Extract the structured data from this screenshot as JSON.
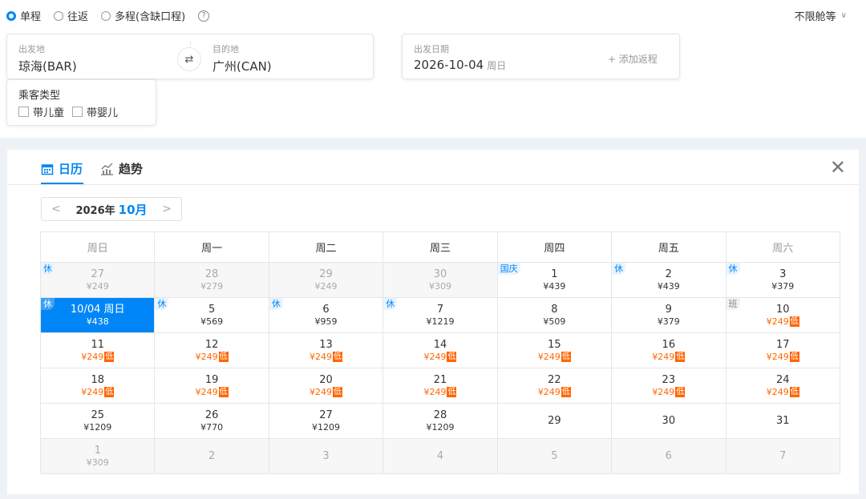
{
  "trip_types": [
    {
      "label": "单程",
      "selected": true
    },
    {
      "label": "往返",
      "selected": false
    },
    {
      "label": "多程(含缺口程)",
      "selected": false
    }
  ],
  "help_icon": "?",
  "cabin": "不限舱等",
  "route": {
    "from_label": "出发地",
    "from_value": "琼海(BAR)",
    "to_label": "目的地",
    "to_value": "广州(CAN)",
    "swap_icon": "⇄"
  },
  "date": {
    "label": "出发日期",
    "value": "2026-10-04",
    "weekday": "周日",
    "add_return": "+ 添加返程"
  },
  "passenger": {
    "label": "乘客类型",
    "options": [
      "带儿童",
      "带婴儿"
    ]
  },
  "tabs": {
    "calendar": "日历",
    "trend": "趋势"
  },
  "close_icon": "✕",
  "month": {
    "year": "2026年",
    "month": "10月"
  },
  "weekdays": [
    "周日",
    "周一",
    "周二",
    "周三",
    "周四",
    "周五",
    "周六"
  ],
  "low_tag": "低",
  "weeks": [
    [
      {
        "day": "27",
        "price": "¥249",
        "tag": "休",
        "dim": true
      },
      {
        "day": "28",
        "price": "¥279",
        "dim": true
      },
      {
        "day": "29",
        "price": "¥249",
        "dim": true
      },
      {
        "day": "30",
        "price": "¥309",
        "dim": true
      },
      {
        "day": "1",
        "price": "¥439",
        "tag": "国庆"
      },
      {
        "day": "2",
        "price": "¥439",
        "tag": "休"
      },
      {
        "day": "3",
        "price": "¥379",
        "tag": "休"
      }
    ],
    [
      {
        "day": "10/04 周日",
        "price": "¥438",
        "tag": "休",
        "selected": true
      },
      {
        "day": "5",
        "price": "¥569",
        "tag": "休"
      },
      {
        "day": "6",
        "price": "¥959",
        "tag": "休"
      },
      {
        "day": "7",
        "price": "¥1219",
        "tag": "休"
      },
      {
        "day": "8",
        "price": "¥509"
      },
      {
        "day": "9",
        "price": "¥379"
      },
      {
        "day": "10",
        "price": "¥249",
        "tag": "班",
        "low": true
      }
    ],
    [
      {
        "day": "11",
        "price": "¥249",
        "low": true
      },
      {
        "day": "12",
        "price": "¥249",
        "low": true
      },
      {
        "day": "13",
        "price": "¥249",
        "low": true
      },
      {
        "day": "14",
        "price": "¥249",
        "low": true
      },
      {
        "day": "15",
        "price": "¥249",
        "low": true
      },
      {
        "day": "16",
        "price": "¥249",
        "low": true
      },
      {
        "day": "17",
        "price": "¥249",
        "low": true
      }
    ],
    [
      {
        "day": "18",
        "price": "¥249",
        "low": true
      },
      {
        "day": "19",
        "price": "¥249",
        "low": true
      },
      {
        "day": "20",
        "price": "¥249",
        "low": true
      },
      {
        "day": "21",
        "price": "¥249",
        "low": true
      },
      {
        "day": "22",
        "price": "¥249",
        "low": true
      },
      {
        "day": "23",
        "price": "¥249",
        "low": true
      },
      {
        "day": "24",
        "price": "¥249",
        "low": true
      }
    ],
    [
      {
        "day": "25",
        "price": "¥1209"
      },
      {
        "day": "26",
        "price": "¥770"
      },
      {
        "day": "27",
        "price": "¥1209"
      },
      {
        "day": "28",
        "price": "¥1209"
      },
      {
        "day": "29"
      },
      {
        "day": "30"
      },
      {
        "day": "31"
      }
    ],
    [
      {
        "day": "1",
        "price": "¥309",
        "dim": true
      },
      {
        "day": "2",
        "dim": true
      },
      {
        "day": "3",
        "dim": true
      },
      {
        "day": "4",
        "dim": true
      },
      {
        "day": "5",
        "dim": true
      },
      {
        "day": "6",
        "dim": true
      },
      {
        "day": "7",
        "dim": true
      }
    ]
  ]
}
